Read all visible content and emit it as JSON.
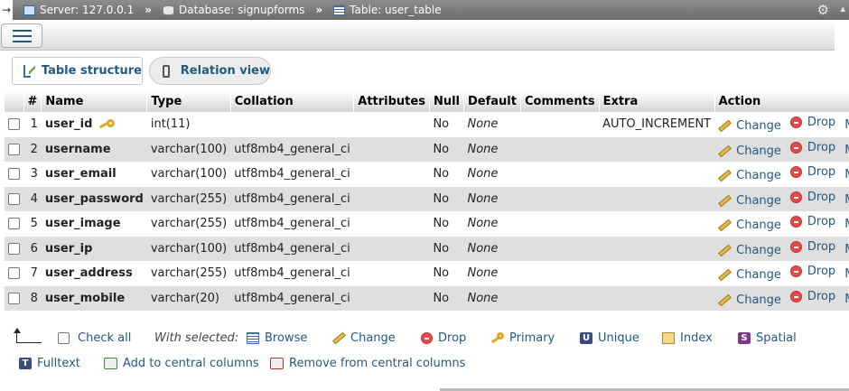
{
  "breadcrumb": {
    "arrow": "→",
    "server": "Server: 127.0.0.1",
    "database": "Database: signupforms",
    "table": "Table: user_table",
    "separator": "»"
  },
  "tabs": {
    "structure": "Table structure",
    "relation": "Relation view"
  },
  "columns": [
    "#",
    "Name",
    "Type",
    "Collation",
    "Attributes",
    "Null",
    "Default",
    "Comments",
    "Extra",
    "Action"
  ],
  "rows": [
    {
      "num": "1",
      "name": "user_id",
      "primary": true,
      "type": "int(11)",
      "collation": "",
      "attributes": "",
      "null": "No",
      "default": "None",
      "comments": "",
      "extra": "AUTO_INCREMENT"
    },
    {
      "num": "2",
      "name": "username",
      "primary": false,
      "type": "varchar(100)",
      "collation": "utf8mb4_general_ci",
      "attributes": "",
      "null": "No",
      "default": "None",
      "comments": "",
      "extra": ""
    },
    {
      "num": "3",
      "name": "user_email",
      "primary": false,
      "type": "varchar(100)",
      "collation": "utf8mb4_general_ci",
      "attributes": "",
      "null": "No",
      "default": "None",
      "comments": "",
      "extra": ""
    },
    {
      "num": "4",
      "name": "user_password",
      "primary": false,
      "type": "varchar(255)",
      "collation": "utf8mb4_general_ci",
      "attributes": "",
      "null": "No",
      "default": "None",
      "comments": "",
      "extra": ""
    },
    {
      "num": "5",
      "name": "user_image",
      "primary": false,
      "type": "varchar(255)",
      "collation": "utf8mb4_general_ci",
      "attributes": "",
      "null": "No",
      "default": "None",
      "comments": "",
      "extra": ""
    },
    {
      "num": "6",
      "name": "user_ip",
      "primary": false,
      "type": "varchar(100)",
      "collation": "utf8mb4_general_ci",
      "attributes": "",
      "null": "No",
      "default": "None",
      "comments": "",
      "extra": ""
    },
    {
      "num": "7",
      "name": "user_address",
      "primary": false,
      "type": "varchar(255)",
      "collation": "utf8mb4_general_ci",
      "attributes": "",
      "null": "No",
      "default": "None",
      "comments": "",
      "extra": ""
    },
    {
      "num": "8",
      "name": "user_mobile",
      "primary": false,
      "type": "varchar(20)",
      "collation": "utf8mb4_general_ci",
      "attributes": "",
      "null": "No",
      "default": "None",
      "comments": "",
      "extra": ""
    }
  ],
  "row_actions": {
    "change": "Change",
    "drop": "Drop",
    "more": "More"
  },
  "bulk": {
    "check_all": "Check all",
    "with_selected": "With selected:",
    "browse": "Browse",
    "change": "Change",
    "drop": "Drop",
    "primary": "Primary",
    "unique": "Unique",
    "index": "Index",
    "spatial": "Spatial",
    "fulltext": "Fulltext",
    "add_central": "Add to central columns",
    "remove_central": "Remove from central columns"
  },
  "icons": {
    "settings": "gear-icon",
    "collapse": "collapse-icon",
    "menu": "hamburger-menu-icon",
    "primary_key": "key-icon"
  },
  "colors": {
    "link": "#235a81",
    "row_alt": "#dfdfdf",
    "topbar": "#7a7a7a"
  }
}
